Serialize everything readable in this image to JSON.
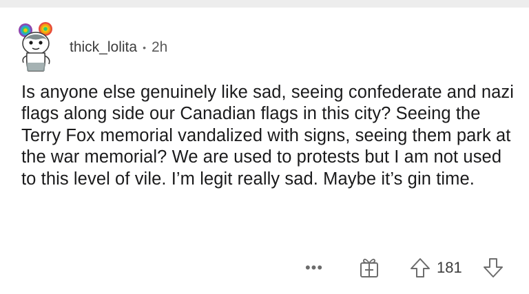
{
  "comment": {
    "author": "thick_lolita",
    "separator": "•",
    "time_ago": "2h",
    "body": "Is anyone else genuinely like sad, seeing confederate and nazi flags along side our Canadian flags in this city? Seeing the Terry Fox memorial vandalized with signs, seeing them park at the war memorial? We are used to protests but I am not used to this level of vile. I’m legit really sad. Maybe it’s gin time."
  },
  "actions": {
    "more_label": "•••",
    "vote_count": "181"
  },
  "icons": {
    "avatar": "snoo-avatar-icon",
    "award": "gift-award-icon",
    "upvote": "upvote-arrow-icon",
    "downvote": "downvote-arrow-icon"
  },
  "colors": {
    "text": "#1a1a1b",
    "meta": "#5a5a5a",
    "top_strip": "#ededed"
  }
}
